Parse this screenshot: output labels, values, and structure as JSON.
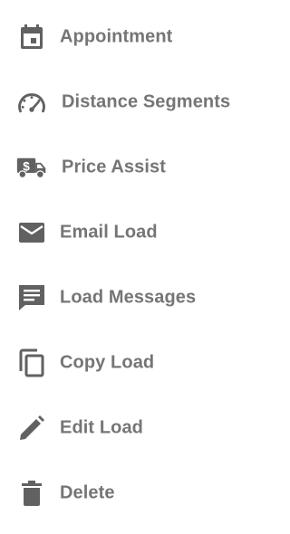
{
  "menu": {
    "icon_color": "#616161",
    "text_color": "#757575",
    "items": [
      {
        "label": "Appointment",
        "icon": "calendar-icon"
      },
      {
        "label": "Distance Segments",
        "icon": "speedometer-icon"
      },
      {
        "label": "Price Assist",
        "icon": "dollar-truck-icon"
      },
      {
        "label": "Email Load",
        "icon": "envelope-icon"
      },
      {
        "label": "Load Messages",
        "icon": "message-icon"
      },
      {
        "label": "Copy Load",
        "icon": "copy-icon"
      },
      {
        "label": "Edit Load",
        "icon": "pencil-icon"
      },
      {
        "label": "Delete",
        "icon": "trash-icon"
      }
    ]
  }
}
